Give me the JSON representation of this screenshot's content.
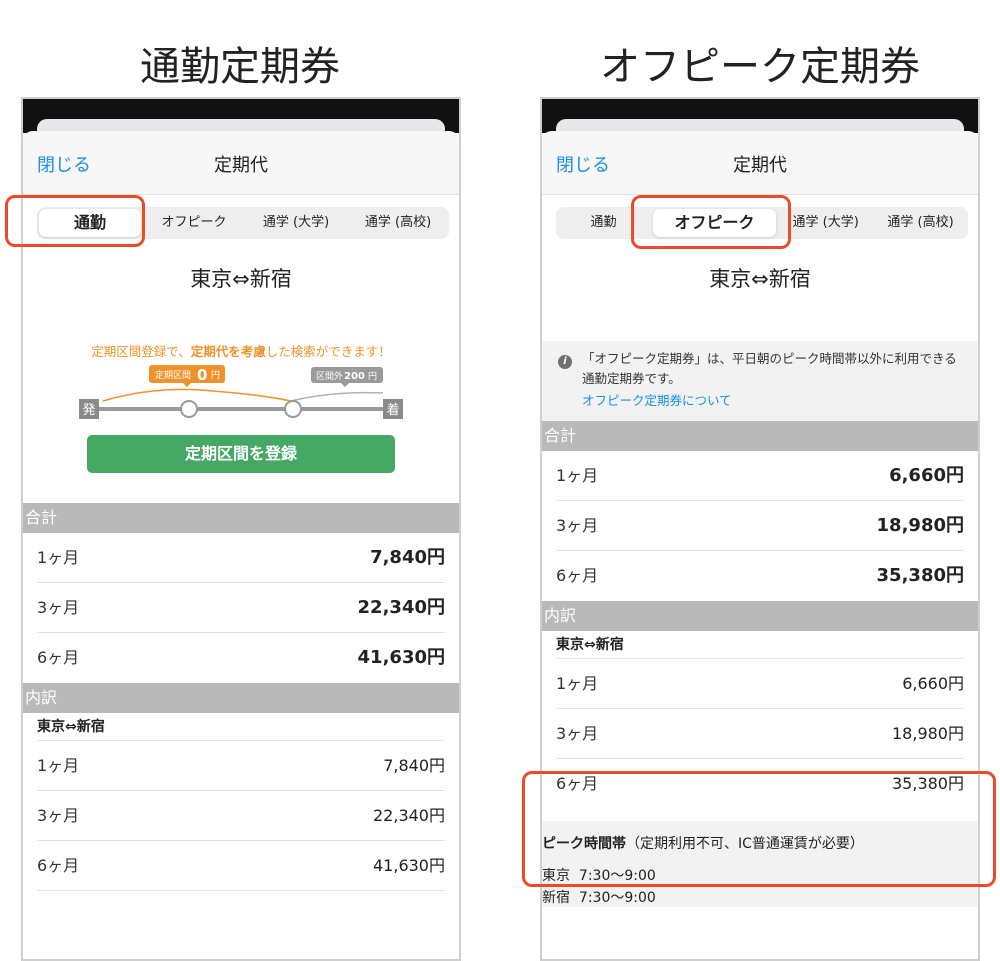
{
  "left": {
    "heading": "通勤定期券",
    "nav": {
      "close": "閉じる",
      "title": "定期代"
    },
    "tabs": [
      "通勤",
      "オフピーク",
      "通学 (大学)",
      "通学 (高校)"
    ],
    "route": "東京⇔新宿",
    "promo": {
      "a": "定期区間登録で、",
      "b": "定期代を考慮",
      "c": "した検索ができます！"
    },
    "diagram": {
      "badge1": "定期区間",
      "badge1_num": "0",
      "badge1_unit": "円",
      "badge2": "区間外",
      "badge2_num": "200",
      "badge2_unit": "円",
      "from": "発",
      "to": "着"
    },
    "register_button": "定期区間を登録",
    "total_header": "合計",
    "totals": [
      {
        "label": "1ヶ月",
        "value": "7,840円"
      },
      {
        "label": "3ヶ月",
        "value": "22,340円"
      },
      {
        "label": "6ヶ月",
        "value": "41,630円"
      }
    ],
    "breakdown_header": "内訳",
    "breakdown_route": "東京⇔新宿",
    "breakdown": [
      {
        "label": "1ヶ月",
        "value": "7,840円"
      },
      {
        "label": "3ヶ月",
        "value": "22,340円"
      },
      {
        "label": "6ヶ月",
        "value": "41,630円"
      }
    ]
  },
  "right": {
    "heading": "オフピーク定期券",
    "nav": {
      "close": "閉じる",
      "title": "定期代"
    },
    "tabs": [
      "通勤",
      "オフピーク",
      "通学 (大学)",
      "通学 (高校)"
    ],
    "route": "東京⇔新宿",
    "info": {
      "text": "「オフピーク定期券」は、平日朝のピーク時間帯以外に利用できる通勤定期券です。",
      "link": "オフピーク定期券について"
    },
    "total_header": "合計",
    "totals": [
      {
        "label": "1ヶ月",
        "value": "6,660円"
      },
      {
        "label": "3ヶ月",
        "value": "18,980円"
      },
      {
        "label": "6ヶ月",
        "value": "35,380円"
      }
    ],
    "breakdown_header": "内訳",
    "breakdown_route": "東京⇔新宿",
    "breakdown": [
      {
        "label": "1ヶ月",
        "value": "6,660円"
      },
      {
        "label": "3ヶ月",
        "value": "18,980円"
      },
      {
        "label": "6ヶ月",
        "value": "35,380円"
      }
    ],
    "peak": {
      "title": "ピーク時間帯",
      "note": "（定期利用不可、IC普通運賃が必要）",
      "stations": [
        {
          "station": "東京",
          "time": "7:30〜9:00"
        },
        {
          "station": "新宿",
          "time": "7:30〜9:00"
        }
      ]
    }
  },
  "colors": {
    "accent": "#1a8ee8",
    "highlight": "#ea4b2a",
    "promo": "#f0922c",
    "button": "#45a864",
    "section": "#b9b9b9"
  }
}
